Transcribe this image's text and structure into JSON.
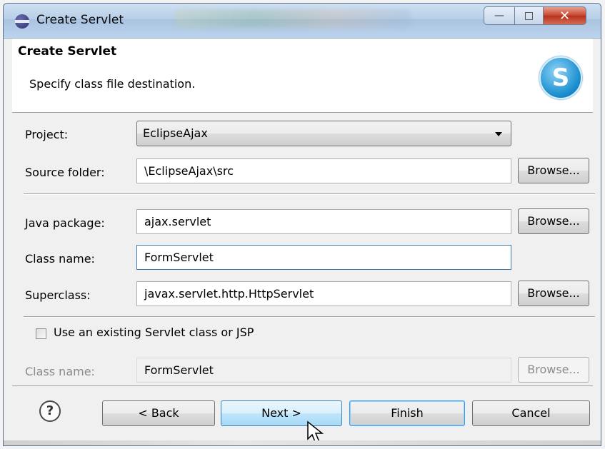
{
  "window": {
    "title": "Create Servlet"
  },
  "header": {
    "title": "Create Servlet",
    "description": "Specify class file destination."
  },
  "form": {
    "project_label": "Project:",
    "project_value": "EclipseAjax",
    "source_folder_label": "Source folder:",
    "source_folder_value": "\\EclipseAjax\\src",
    "java_package_label": "Java package:",
    "java_package_value": "ajax.servlet",
    "class_name_label": "Class name:",
    "class_name_value": "FormServlet",
    "superclass_label": "Superclass:",
    "superclass_value": "javax.servlet.http.HttpServlet",
    "use_existing_label": "Use an existing Servlet class or JSP",
    "use_existing_checked": false,
    "existing_class_label": "Class name:",
    "existing_class_value": "FormServlet",
    "browse_label": "Browse..."
  },
  "footer": {
    "help_symbol": "?",
    "back_label": "< Back",
    "next_label": "Next >",
    "finish_label": "Finish",
    "cancel_label": "Cancel"
  },
  "icons": {
    "app": "eclipse-icon",
    "logo": "servlet-s-icon",
    "help": "help-icon",
    "cursor": "mouse-pointer-icon"
  },
  "colors": {
    "focus_border": "#3d7bad",
    "hover_button": "#bee6fd",
    "close_button": "#c9432a"
  }
}
